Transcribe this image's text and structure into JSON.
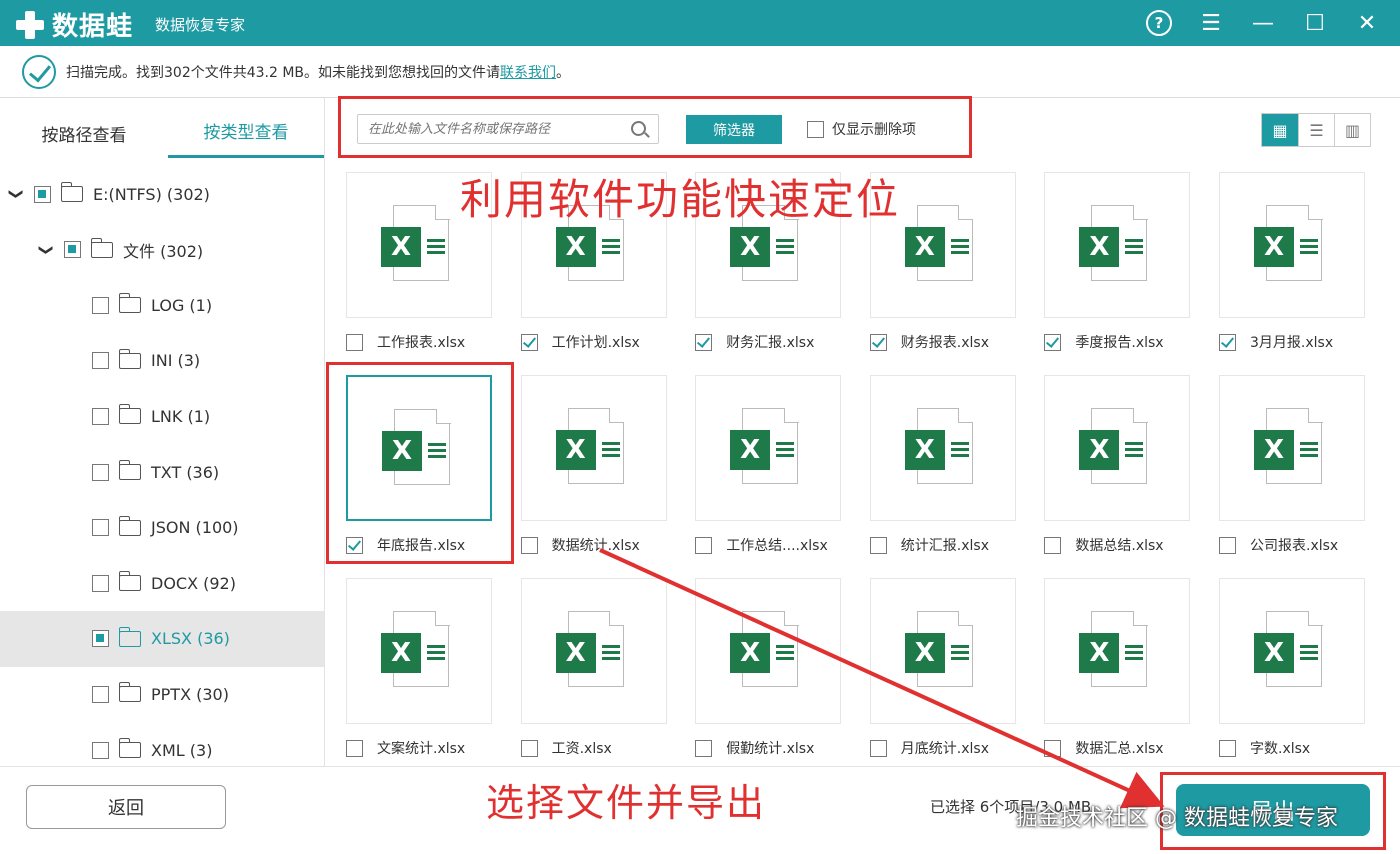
{
  "titlebar": {
    "app_name": "数据蛙",
    "subtitle": "数据恢复专家",
    "help_icon": "?",
    "menu_icon": "☰",
    "minimize_icon": "—",
    "maximize_icon": "☐",
    "close_icon": "✕"
  },
  "status": {
    "text": "扫描完成。找到302个文件共43.2 MB。如未能找到您想找回的文件请",
    "link": "联系我们",
    "tail": "。"
  },
  "sidebar": {
    "tabs": [
      {
        "label": "按路径查看"
      },
      {
        "label": "按类型查看"
      }
    ],
    "tree": [
      {
        "label": "E:(NTFS) (302)",
        "arrow": "❯",
        "state": "partial"
      },
      {
        "label": "文件 (302)",
        "arrow": "❯",
        "state": "partial"
      },
      {
        "label": "LOG (1)",
        "state": "none"
      },
      {
        "label": "INI (3)",
        "state": "none"
      },
      {
        "label": "LNK (1)",
        "state": "none"
      },
      {
        "label": "TXT (36)",
        "state": "none"
      },
      {
        "label": "JSON (100)",
        "state": "none"
      },
      {
        "label": "DOCX (92)",
        "state": "none"
      },
      {
        "label": "XLSX (36)",
        "state": "partial"
      },
      {
        "label": "PPTX (30)",
        "state": "none"
      },
      {
        "label": "XML (3)",
        "state": "none"
      }
    ]
  },
  "toolbar": {
    "search_placeholder": "在此处输入文件名称或保存路径",
    "filter_label": "筛选器",
    "only_deleted_label": "仅显示删除项",
    "view_icons": [
      "grid-view-icon",
      "list-view-icon",
      "detail-view-icon"
    ]
  },
  "annotations": {
    "top": "利用软件功能快速定位",
    "bottom": "选择文件并导出"
  },
  "files": [
    {
      "name": "工作报表.xlsx",
      "checked": false
    },
    {
      "name": "工作计划.xlsx",
      "checked": true
    },
    {
      "name": "财务汇报.xlsx",
      "checked": true
    },
    {
      "name": "财务报表.xlsx",
      "checked": true
    },
    {
      "name": "季度报告.xlsx",
      "checked": true
    },
    {
      "name": "3月月报.xlsx",
      "checked": true
    },
    {
      "name": "年底报告.xlsx",
      "checked": true
    },
    {
      "name": "数据统计.xlsx",
      "checked": false
    },
    {
      "name": "工作总结....xlsx",
      "checked": false
    },
    {
      "name": "统计汇报.xlsx",
      "checked": false
    },
    {
      "name": "数据总结.xlsx",
      "checked": false
    },
    {
      "name": "公司报表.xlsx",
      "checked": false
    },
    {
      "name": "文案统计.xlsx",
      "checked": false
    },
    {
      "name": "工资.xlsx",
      "checked": false
    },
    {
      "name": "假勤统计.xlsx",
      "checked": false
    },
    {
      "name": "月底统计.xlsx",
      "checked": false
    },
    {
      "name": "数据汇总.xlsx",
      "checked": false
    },
    {
      "name": "字数.xlsx",
      "checked": false
    }
  ],
  "file_icon_letter": "X",
  "bottom": {
    "back_label": "返回",
    "selected_info": "已选择 6个项目/3.0 MB",
    "export_label": "导出",
    "watermark": "掘金技术社区 @ 数据蛙恢复专家"
  },
  "colors": {
    "accent": "#1e9aa3",
    "annotation_red": "#e03030",
    "excel_green": "#1f7a4a"
  }
}
